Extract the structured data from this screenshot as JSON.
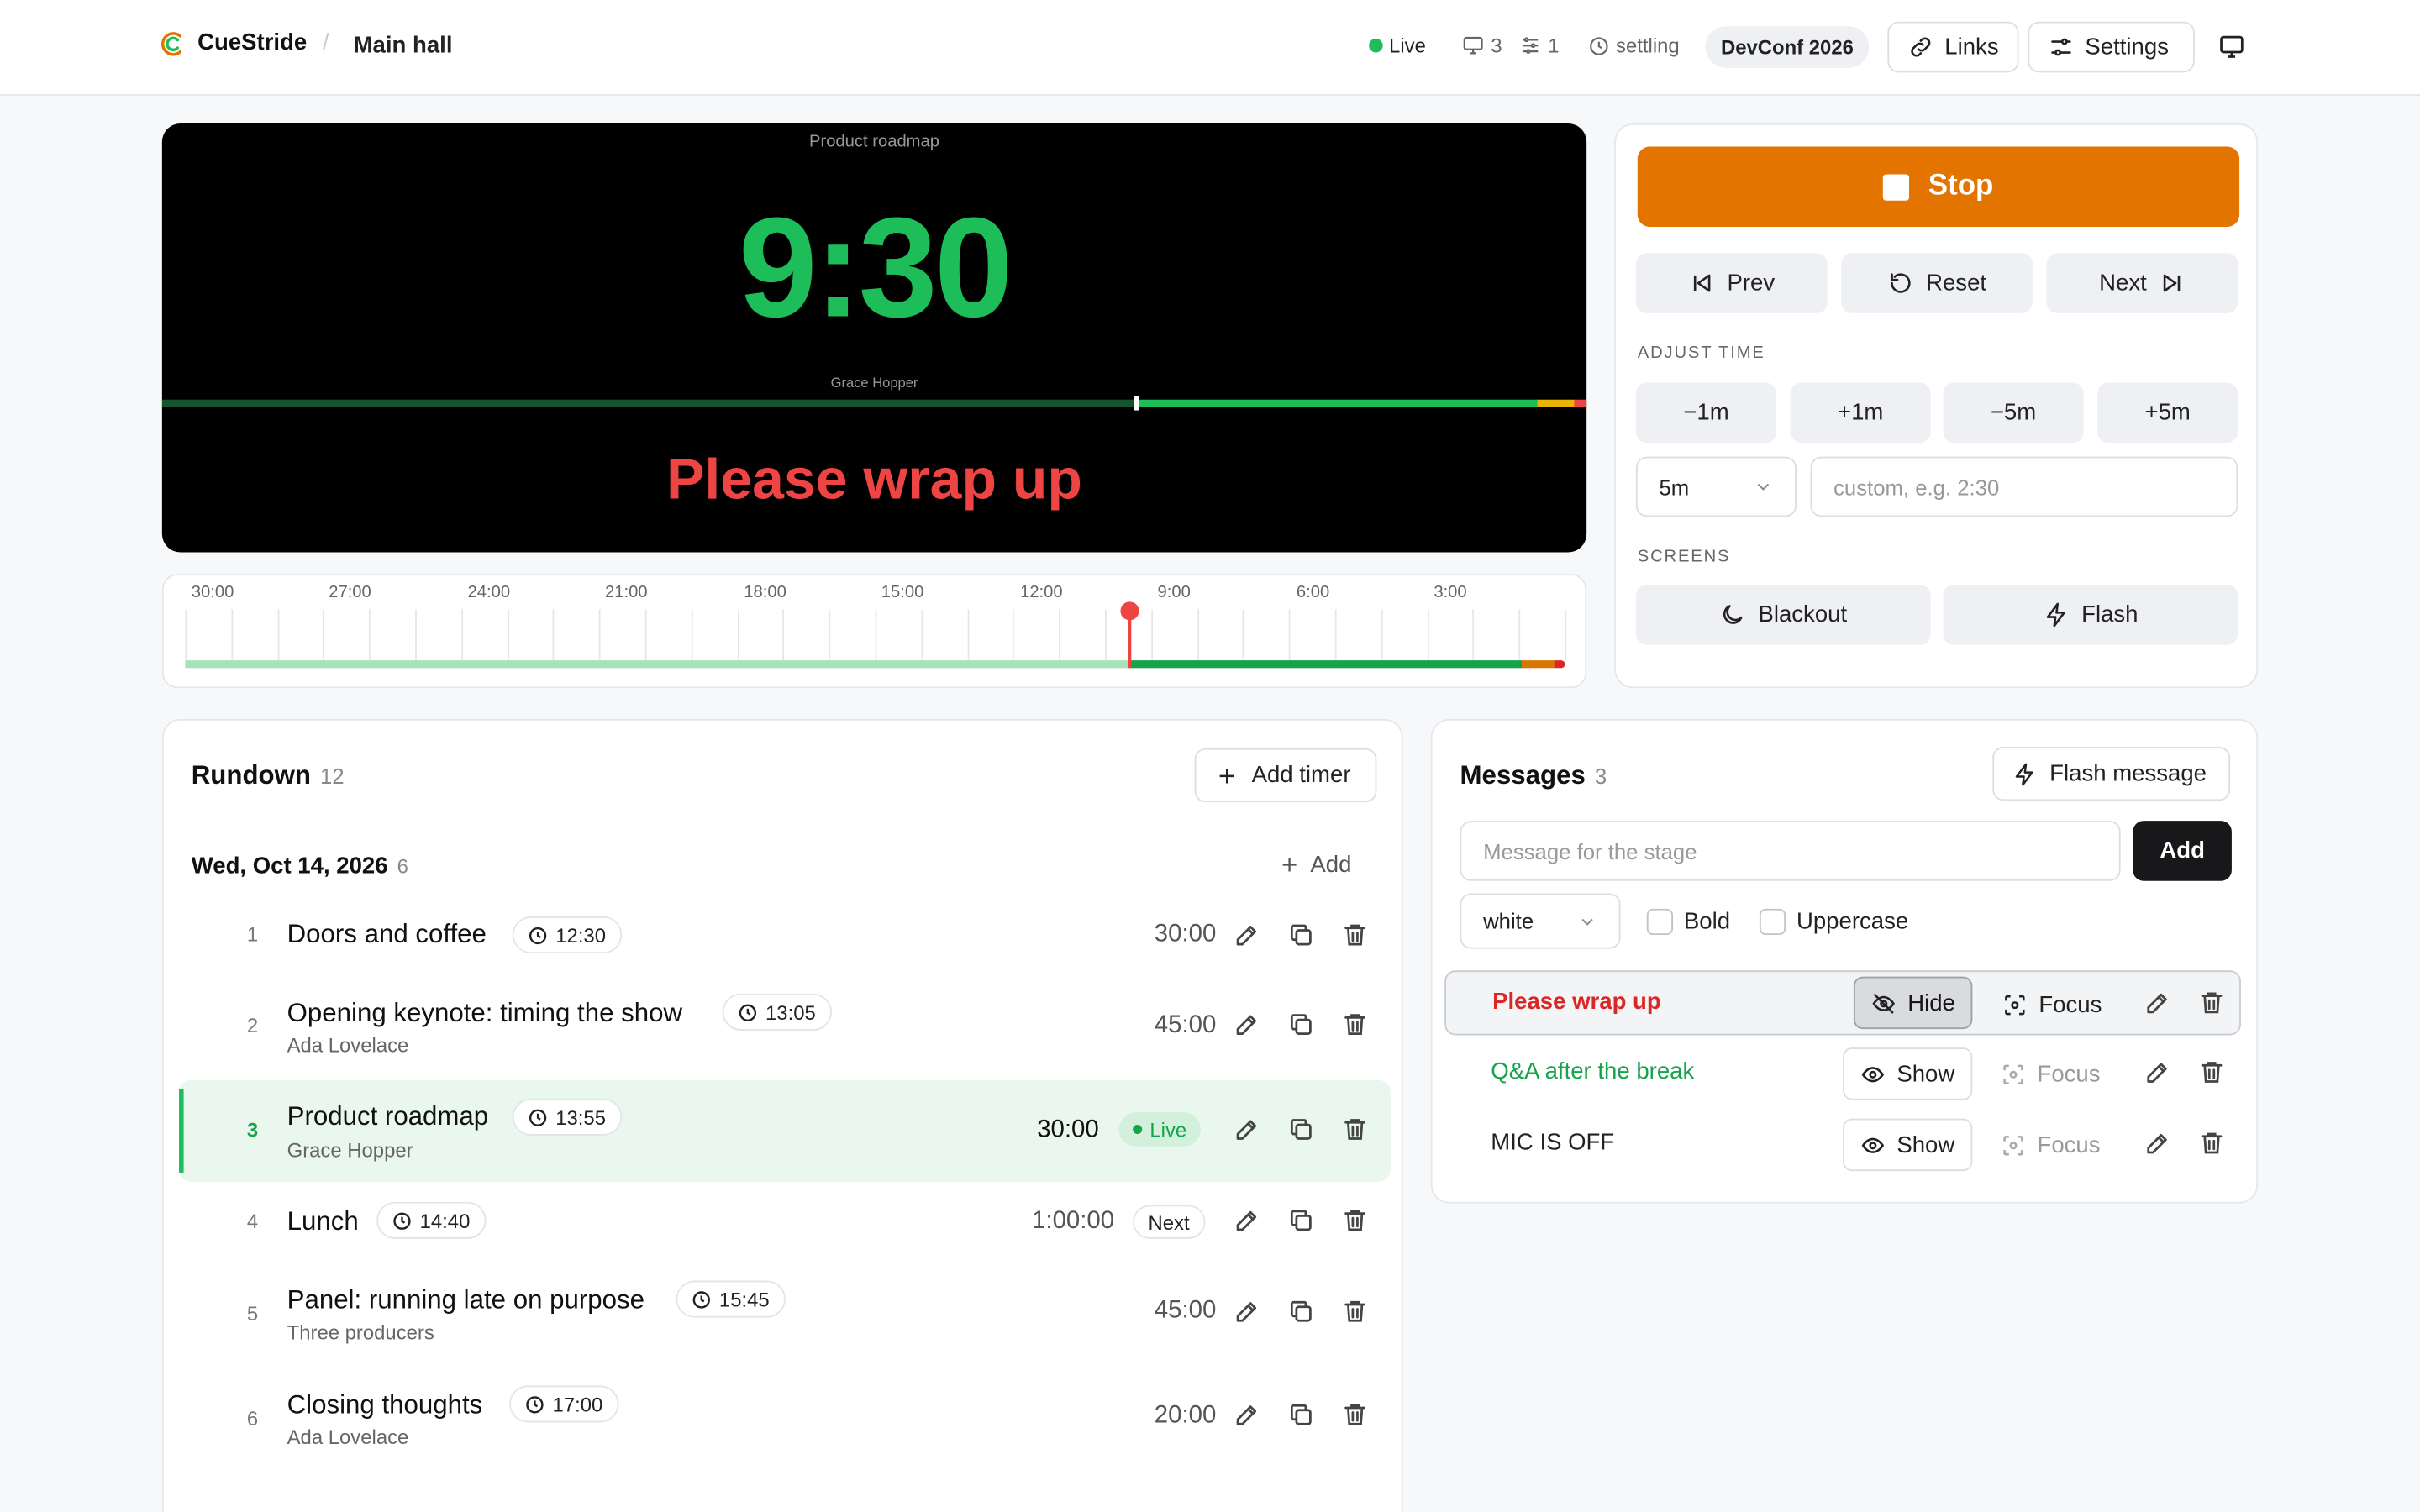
{
  "app": {
    "brand": "CueStride",
    "room": "Main hall"
  },
  "header": {
    "live_label": "Live",
    "screens_count": "3",
    "controllers_count": "1",
    "sync_status": "settling",
    "event_name": "DevConf 2026",
    "links_label": "Links",
    "settings_label": "Settings"
  },
  "colors": {
    "accent_orange": "#e37400",
    "live_green": "#1dbd5a",
    "warning_red": "#ef4444",
    "timer_green": "#1dbd5a"
  },
  "stage": {
    "title": "Product roadmap",
    "time": "9:30",
    "speaker": "Grace Hopper",
    "message": "Please wrap up",
    "elapsed_fraction": 0.683
  },
  "timeline": {
    "labels": [
      "30:00",
      "27:00",
      "24:00",
      "21:00",
      "18:00",
      "15:00",
      "12:00",
      "9:00",
      "6:00",
      "3:00"
    ]
  },
  "controls": {
    "stop_label": "Stop",
    "prev_label": "Prev",
    "reset_label": "Reset",
    "next_label": "Next",
    "adjust_heading": "ADJUST TIME",
    "minus1": "−1m",
    "plus1": "+1m",
    "minus5": "−5m",
    "plus5": "+5m",
    "step_value": "5m",
    "custom_placeholder": "custom, e.g. 2:30",
    "screens_heading": "SCREENS",
    "blackout_label": "Blackout",
    "flash_label": "Flash"
  },
  "rundown": {
    "title": "Rundown",
    "count": "12",
    "add_timer_label": "Add timer",
    "day_label": "Wed, Oct 14, 2026",
    "day_count": "6",
    "add_label": "Add",
    "items": [
      {
        "num": "1",
        "title": "Doors and coffee",
        "start": "12:30",
        "speaker": "",
        "duration": "30:00",
        "badge": ""
      },
      {
        "num": "2",
        "title": "Opening keynote: timing the show",
        "start": "13:05",
        "speaker": "Ada Lovelace",
        "duration": "45:00",
        "badge": ""
      },
      {
        "num": "3",
        "title": "Product roadmap",
        "start": "13:55",
        "speaker": "Grace Hopper",
        "duration": "30:00",
        "badge": "Live"
      },
      {
        "num": "4",
        "title": "Lunch",
        "start": "14:40",
        "speaker": "",
        "duration": "1:00:00",
        "badge": "Next"
      },
      {
        "num": "5",
        "title": "Panel: running late on purpose",
        "start": "15:45",
        "speaker": "Three producers",
        "duration": "45:00",
        "badge": ""
      },
      {
        "num": "6",
        "title": "Closing thoughts",
        "start": "17:00",
        "speaker": "Ada Lovelace",
        "duration": "20:00",
        "badge": ""
      }
    ]
  },
  "messages": {
    "title": "Messages",
    "count": "3",
    "flash_message_label": "Flash message",
    "input_placeholder": "Message for the stage",
    "add_label": "Add",
    "color_value": "white",
    "bold_label": "Bold",
    "uppercase_label": "Uppercase",
    "focus_label": "Focus",
    "items": [
      {
        "text": "Please wrap up",
        "color": "#dc2626",
        "toggle": "Hide"
      },
      {
        "text": "Q&A after the break",
        "color": "#16a34a",
        "toggle": "Show"
      },
      {
        "text": "MIC IS OFF",
        "color": "#222222",
        "toggle": "Show"
      }
    ]
  }
}
